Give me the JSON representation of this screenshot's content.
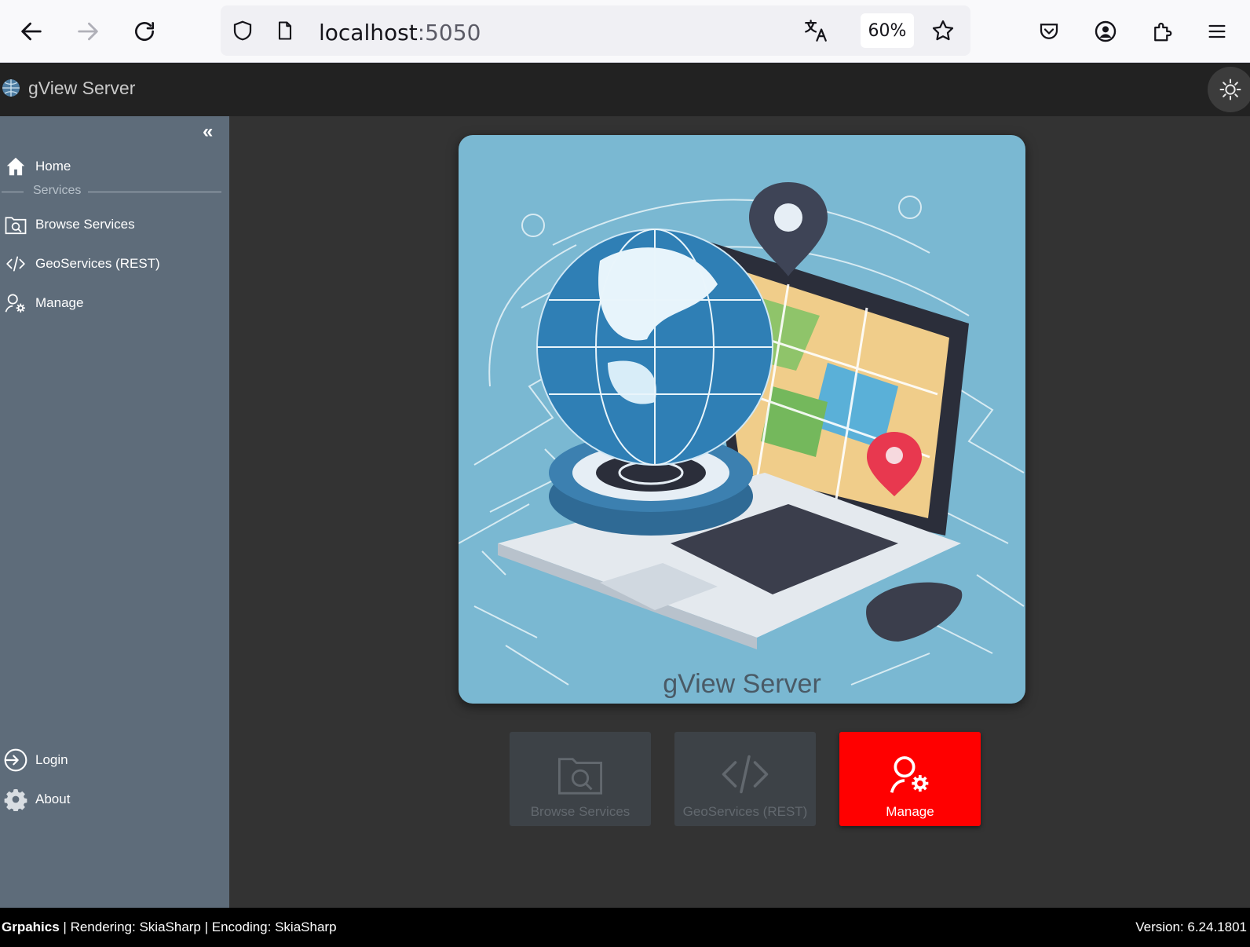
{
  "browser": {
    "url_host": "localhost",
    "url_port": ":5050",
    "zoom": "60%"
  },
  "app": {
    "title": "gView Server"
  },
  "sidebar": {
    "collapse_glyph": "«",
    "items": [
      {
        "label": "Home",
        "icon": "home-icon"
      },
      {
        "label": "Browse Services",
        "icon": "browse-icon"
      },
      {
        "label": "GeoServices (REST)",
        "icon": "code-icon"
      },
      {
        "label": "Manage",
        "icon": "manage-icon"
      }
    ],
    "section_services": "Services",
    "bottom_items": [
      {
        "label": "Login",
        "icon": "login-icon"
      },
      {
        "label": "About",
        "icon": "gear-icon"
      }
    ]
  },
  "hero": {
    "title": "gView Server"
  },
  "tiles": [
    {
      "label": "Browse Services",
      "state": "disabled"
    },
    {
      "label": "GeoServices (REST)",
      "state": "disabled"
    },
    {
      "label": "Manage",
      "state": "active"
    }
  ],
  "footer": {
    "graphics_label": "Grpahics",
    "graphics_info": " | Rendering: SkiaSharp | Encoding: SkiaSharp",
    "version": "Version: 6.24.1801"
  },
  "colors": {
    "header_bg": "#222222",
    "sidebar_bg": "#5e6c7a",
    "main_bg": "#333333",
    "accent_red": "#ff0000"
  }
}
